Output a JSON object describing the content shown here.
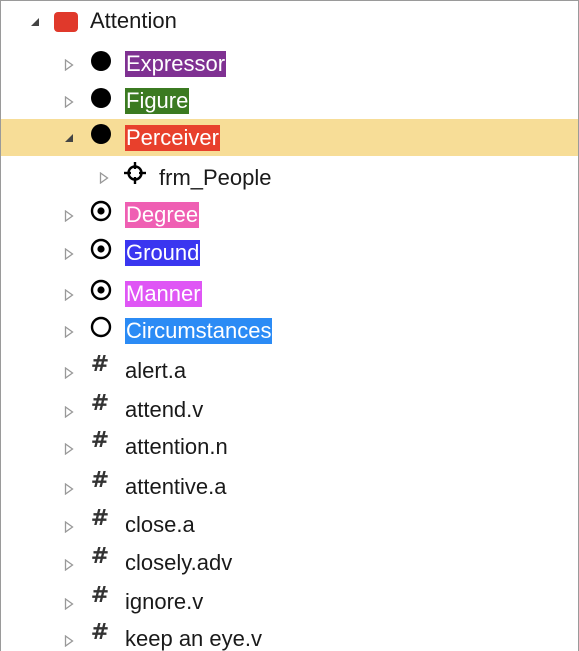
{
  "tree": {
    "root": {
      "label": "Attention",
      "icon": "frame-icon",
      "color": "#e0392b"
    },
    "elements": [
      {
        "label": "Expressor",
        "icon": "filled-circle-icon",
        "color": "#7f3192"
      },
      {
        "label": "Figure",
        "icon": "filled-circle-icon",
        "color": "#3b7a21"
      },
      {
        "label": "Perceiver",
        "icon": "filled-circle-icon",
        "color": "#e8402c",
        "selected": true
      },
      {
        "label": "Degree",
        "icon": "dotted-circle-icon",
        "color": "#ef5fb3"
      },
      {
        "label": "Ground",
        "icon": "dotted-circle-icon",
        "color": "#3a36f0"
      },
      {
        "label": "Manner",
        "icon": "dotted-circle-icon",
        "color": "#df56f5"
      },
      {
        "label": "Circumstances",
        "icon": "empty-circle-icon",
        "color": "#2b8bf5"
      }
    ],
    "perceiver_child": {
      "label": "frm_People",
      "icon": "crosshair-icon"
    },
    "lexical_units": [
      {
        "label": "alert.a",
        "icon": "hash-icon"
      },
      {
        "label": "attend.v",
        "icon": "hash-icon"
      },
      {
        "label": "attention.n",
        "icon": "hash-icon"
      },
      {
        "label": "attentive.a",
        "icon": "hash-icon"
      },
      {
        "label": "close.a",
        "icon": "hash-icon"
      },
      {
        "label": "closely.adv",
        "icon": "hash-icon"
      },
      {
        "label": "ignore.v",
        "icon": "hash-icon"
      },
      {
        "label": "keep an eye.v",
        "icon": "hash-icon"
      }
    ]
  }
}
